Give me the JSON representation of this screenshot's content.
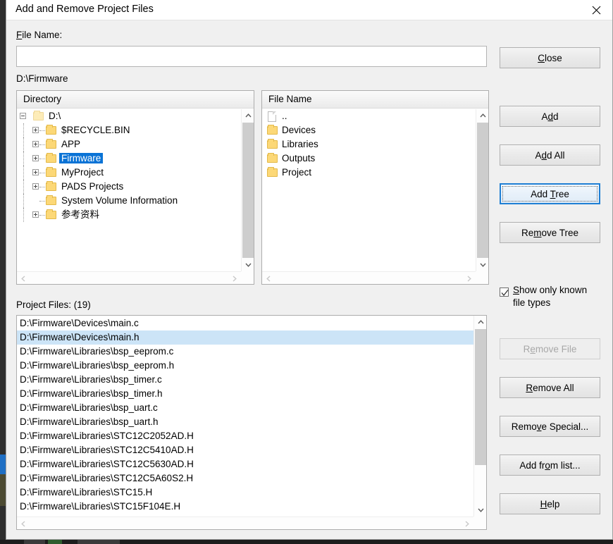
{
  "window": {
    "title": "Add and Remove Project Files",
    "close_icon": "close-icon"
  },
  "form": {
    "file_name_label": "File Name:",
    "file_name_accel": "F",
    "file_name_value": "",
    "file_name_placeholder": "",
    "current_path": "D:\\Firmware"
  },
  "directory_panel": {
    "header": "Directory",
    "items": [
      {
        "label": "D:\\",
        "depth": 0,
        "expander": "minus",
        "icon": "folder-icon",
        "selected": false
      },
      {
        "label": "$RECYCLE.BIN",
        "depth": 1,
        "expander": "plus",
        "icon": "folder-icon",
        "selected": false
      },
      {
        "label": "APP",
        "depth": 1,
        "expander": "plus",
        "icon": "folder-icon",
        "selected": false
      },
      {
        "label": "Firmware",
        "depth": 1,
        "expander": "plus",
        "icon": "folder-icon",
        "selected": true
      },
      {
        "label": "MyProject",
        "depth": 1,
        "expander": "plus",
        "icon": "folder-icon",
        "selected": false
      },
      {
        "label": "PADS Projects",
        "depth": 1,
        "expander": "plus",
        "icon": "folder-icon",
        "selected": false
      },
      {
        "label": "System Volume Information",
        "depth": 1,
        "expander": "none",
        "icon": "folder-icon",
        "selected": false
      },
      {
        "label": "参考资料",
        "depth": 1,
        "expander": "plus",
        "icon": "folder-icon",
        "selected": false
      }
    ]
  },
  "file_panel": {
    "header": "File Name",
    "items": [
      {
        "label": "..",
        "icon": "document-icon"
      },
      {
        "label": "Devices",
        "icon": "folder-icon"
      },
      {
        "label": "Libraries",
        "icon": "folder-icon"
      },
      {
        "label": "Outputs",
        "icon": "folder-icon"
      },
      {
        "label": "Project",
        "icon": "folder-icon"
      }
    ]
  },
  "project_files": {
    "label": "Project Files: (19)",
    "count": 19,
    "rows": [
      {
        "path": "D:\\Firmware\\Devices\\main.c",
        "selected": false
      },
      {
        "path": "D:\\Firmware\\Devices\\main.h",
        "selected": true
      },
      {
        "path": "D:\\Firmware\\Libraries\\bsp_eeprom.c",
        "selected": false
      },
      {
        "path": "D:\\Firmware\\Libraries\\bsp_eeprom.h",
        "selected": false
      },
      {
        "path": "D:\\Firmware\\Libraries\\bsp_timer.c",
        "selected": false
      },
      {
        "path": "D:\\Firmware\\Libraries\\bsp_timer.h",
        "selected": false
      },
      {
        "path": "D:\\Firmware\\Libraries\\bsp_uart.c",
        "selected": false
      },
      {
        "path": "D:\\Firmware\\Libraries\\bsp_uart.h",
        "selected": false
      },
      {
        "path": "D:\\Firmware\\Libraries\\STC12C2052AD.H",
        "selected": false
      },
      {
        "path": "D:\\Firmware\\Libraries\\STC12C5410AD.H",
        "selected": false
      },
      {
        "path": "D:\\Firmware\\Libraries\\STC12C5630AD.H",
        "selected": false
      },
      {
        "path": "D:\\Firmware\\Libraries\\STC12C5A60S2.H",
        "selected": false
      },
      {
        "path": "D:\\Firmware\\Libraries\\STC15.H",
        "selected": false
      },
      {
        "path": "D:\\Firmware\\Libraries\\STC15F104E.H",
        "selected": false
      }
    ]
  },
  "buttons": {
    "close": {
      "pre": "",
      "accel": "C",
      "post": "lose",
      "state": "normal"
    },
    "add": {
      "pre": "A",
      "accel": "d",
      "post": "d",
      "state": "normal"
    },
    "add_all": {
      "pre": "A",
      "accel": "d",
      "post": "d All",
      "state": "normal"
    },
    "add_tree": {
      "pre": "Add ",
      "accel": "T",
      "post": "ree",
      "state": "focused"
    },
    "remove_tree": {
      "pre": "Re",
      "accel": "m",
      "post": "ove Tree",
      "state": "normal"
    },
    "remove_file": {
      "pre": "R",
      "accel": "e",
      "post": "move File",
      "state": "disabled"
    },
    "remove_all": {
      "pre": "",
      "accel": "R",
      "post": "emove All",
      "state": "normal"
    },
    "remove_special": {
      "pre": "Remo",
      "accel": "v",
      "post": "e Special...",
      "state": "normal"
    },
    "add_from_list": {
      "pre": "Add fr",
      "accel": "o",
      "post": "m list...",
      "state": "normal"
    },
    "help": {
      "pre": "",
      "accel": "H",
      "post": "elp",
      "state": "normal"
    }
  },
  "checkbox": {
    "label_line1": "how only known",
    "accel": "S",
    "label_line2": "file types",
    "checked": true
  },
  "colors": {
    "selection_blue": "#0a73d6",
    "list_selection": "#cce4f7",
    "focus_border": "#1f7fd4",
    "dialog_bg": "#f0f0f0",
    "folder_yellow": "#fcd877"
  }
}
